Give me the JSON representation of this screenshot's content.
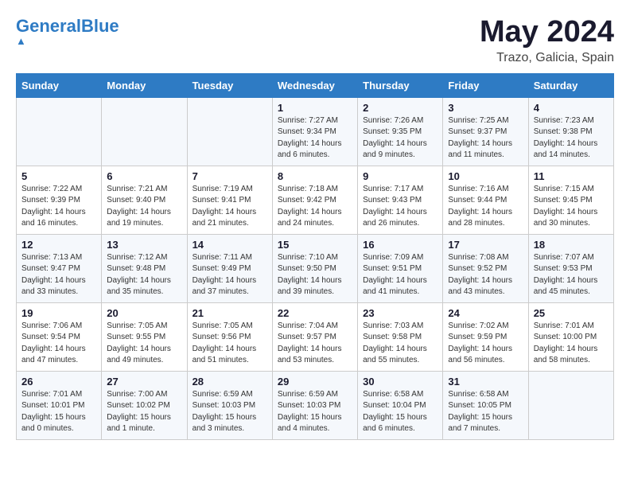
{
  "header": {
    "logo_general": "General",
    "logo_blue": "Blue",
    "month": "May 2024",
    "location": "Trazo, Galicia, Spain"
  },
  "weekdays": [
    "Sunday",
    "Monday",
    "Tuesday",
    "Wednesday",
    "Thursday",
    "Friday",
    "Saturday"
  ],
  "weeks": [
    [
      {
        "day": "",
        "info": ""
      },
      {
        "day": "",
        "info": ""
      },
      {
        "day": "",
        "info": ""
      },
      {
        "day": "1",
        "info": "Sunrise: 7:27 AM\nSunset: 9:34 PM\nDaylight: 14 hours\nand 6 minutes."
      },
      {
        "day": "2",
        "info": "Sunrise: 7:26 AM\nSunset: 9:35 PM\nDaylight: 14 hours\nand 9 minutes."
      },
      {
        "day": "3",
        "info": "Sunrise: 7:25 AM\nSunset: 9:37 PM\nDaylight: 14 hours\nand 11 minutes."
      },
      {
        "day": "4",
        "info": "Sunrise: 7:23 AM\nSunset: 9:38 PM\nDaylight: 14 hours\nand 14 minutes."
      }
    ],
    [
      {
        "day": "5",
        "info": "Sunrise: 7:22 AM\nSunset: 9:39 PM\nDaylight: 14 hours\nand 16 minutes."
      },
      {
        "day": "6",
        "info": "Sunrise: 7:21 AM\nSunset: 9:40 PM\nDaylight: 14 hours\nand 19 minutes."
      },
      {
        "day": "7",
        "info": "Sunrise: 7:19 AM\nSunset: 9:41 PM\nDaylight: 14 hours\nand 21 minutes."
      },
      {
        "day": "8",
        "info": "Sunrise: 7:18 AM\nSunset: 9:42 PM\nDaylight: 14 hours\nand 24 minutes."
      },
      {
        "day": "9",
        "info": "Sunrise: 7:17 AM\nSunset: 9:43 PM\nDaylight: 14 hours\nand 26 minutes."
      },
      {
        "day": "10",
        "info": "Sunrise: 7:16 AM\nSunset: 9:44 PM\nDaylight: 14 hours\nand 28 minutes."
      },
      {
        "day": "11",
        "info": "Sunrise: 7:15 AM\nSunset: 9:45 PM\nDaylight: 14 hours\nand 30 minutes."
      }
    ],
    [
      {
        "day": "12",
        "info": "Sunrise: 7:13 AM\nSunset: 9:47 PM\nDaylight: 14 hours\nand 33 minutes."
      },
      {
        "day": "13",
        "info": "Sunrise: 7:12 AM\nSunset: 9:48 PM\nDaylight: 14 hours\nand 35 minutes."
      },
      {
        "day": "14",
        "info": "Sunrise: 7:11 AM\nSunset: 9:49 PM\nDaylight: 14 hours\nand 37 minutes."
      },
      {
        "day": "15",
        "info": "Sunrise: 7:10 AM\nSunset: 9:50 PM\nDaylight: 14 hours\nand 39 minutes."
      },
      {
        "day": "16",
        "info": "Sunrise: 7:09 AM\nSunset: 9:51 PM\nDaylight: 14 hours\nand 41 minutes."
      },
      {
        "day": "17",
        "info": "Sunrise: 7:08 AM\nSunset: 9:52 PM\nDaylight: 14 hours\nand 43 minutes."
      },
      {
        "day": "18",
        "info": "Sunrise: 7:07 AM\nSunset: 9:53 PM\nDaylight: 14 hours\nand 45 minutes."
      }
    ],
    [
      {
        "day": "19",
        "info": "Sunrise: 7:06 AM\nSunset: 9:54 PM\nDaylight: 14 hours\nand 47 minutes."
      },
      {
        "day": "20",
        "info": "Sunrise: 7:05 AM\nSunset: 9:55 PM\nDaylight: 14 hours\nand 49 minutes."
      },
      {
        "day": "21",
        "info": "Sunrise: 7:05 AM\nSunset: 9:56 PM\nDaylight: 14 hours\nand 51 minutes."
      },
      {
        "day": "22",
        "info": "Sunrise: 7:04 AM\nSunset: 9:57 PM\nDaylight: 14 hours\nand 53 minutes."
      },
      {
        "day": "23",
        "info": "Sunrise: 7:03 AM\nSunset: 9:58 PM\nDaylight: 14 hours\nand 55 minutes."
      },
      {
        "day": "24",
        "info": "Sunrise: 7:02 AM\nSunset: 9:59 PM\nDaylight: 14 hours\nand 56 minutes."
      },
      {
        "day": "25",
        "info": "Sunrise: 7:01 AM\nSunset: 10:00 PM\nDaylight: 14 hours\nand 58 minutes."
      }
    ],
    [
      {
        "day": "26",
        "info": "Sunrise: 7:01 AM\nSunset: 10:01 PM\nDaylight: 15 hours\nand 0 minutes."
      },
      {
        "day": "27",
        "info": "Sunrise: 7:00 AM\nSunset: 10:02 PM\nDaylight: 15 hours\nand 1 minute."
      },
      {
        "day": "28",
        "info": "Sunrise: 6:59 AM\nSunset: 10:03 PM\nDaylight: 15 hours\nand 3 minutes."
      },
      {
        "day": "29",
        "info": "Sunrise: 6:59 AM\nSunset: 10:03 PM\nDaylight: 15 hours\nand 4 minutes."
      },
      {
        "day": "30",
        "info": "Sunrise: 6:58 AM\nSunset: 10:04 PM\nDaylight: 15 hours\nand 6 minutes."
      },
      {
        "day": "31",
        "info": "Sunrise: 6:58 AM\nSunset: 10:05 PM\nDaylight: 15 hours\nand 7 minutes."
      },
      {
        "day": "",
        "info": ""
      }
    ]
  ]
}
